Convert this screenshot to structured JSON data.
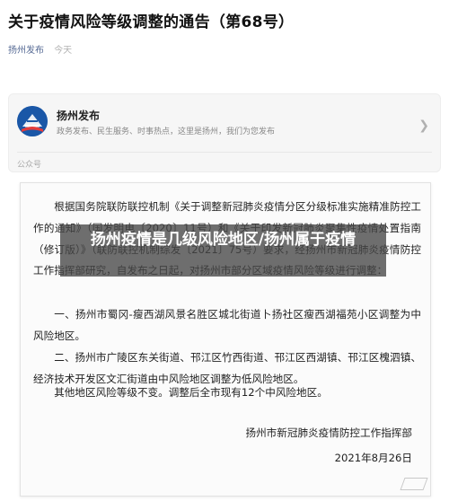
{
  "article": {
    "title": "关于疫情风险等级调整的通告（第68号）",
    "source": "扬州发布",
    "time": "今天"
  },
  "account": {
    "name": "扬州发布",
    "description": "政务发布、民生服务、时事热点，这里是扬州，我们为您发布",
    "type_label": "公众号",
    "logo_icon": "yangzhou-fabu-logo",
    "chevron_icon": "chevron-right-icon"
  },
  "document": {
    "p1": "根据国务院联防联控机制《关于调整新冠肺炎疫情分区分级标准实施精准防控工作的通知》（国发明电〔2020〕11号）和《关于印发新冠肺炎聚集性疫情处置指南（修订版）》（联防联控机制综发〔2021〕75号）要求，经扬州市新冠肺炎疫情防控工作指挥部研究，自发布之日起，对扬州市部分区域疫情风险等级进行调整：",
    "p2": "一、扬州市蜀冈-瘦西湖风景名胜区城北街道卜扬社区瘦西湖福苑小区调整为中风险地区。",
    "p3": "二、扬州市广陵区东关街道、邗江区竹西街道、邗江区西湖镇、邗江区槐泗镇、经济技术开发区文汇街道由中风险地区调整为低风险地区。",
    "p4": "其他地区风险等级不变。调整后全市现有12个中风险地区。",
    "signature": "扬州市新冠肺炎疫情防控工作指挥部",
    "date": "2021年8月26日"
  },
  "overlay": {
    "caption": "扬州疫情是几级风险地区/扬州属于疫情"
  },
  "colors": {
    "link": "#576b95",
    "logo_bg": "#1a57a7",
    "overlay_bg": "#464646"
  }
}
